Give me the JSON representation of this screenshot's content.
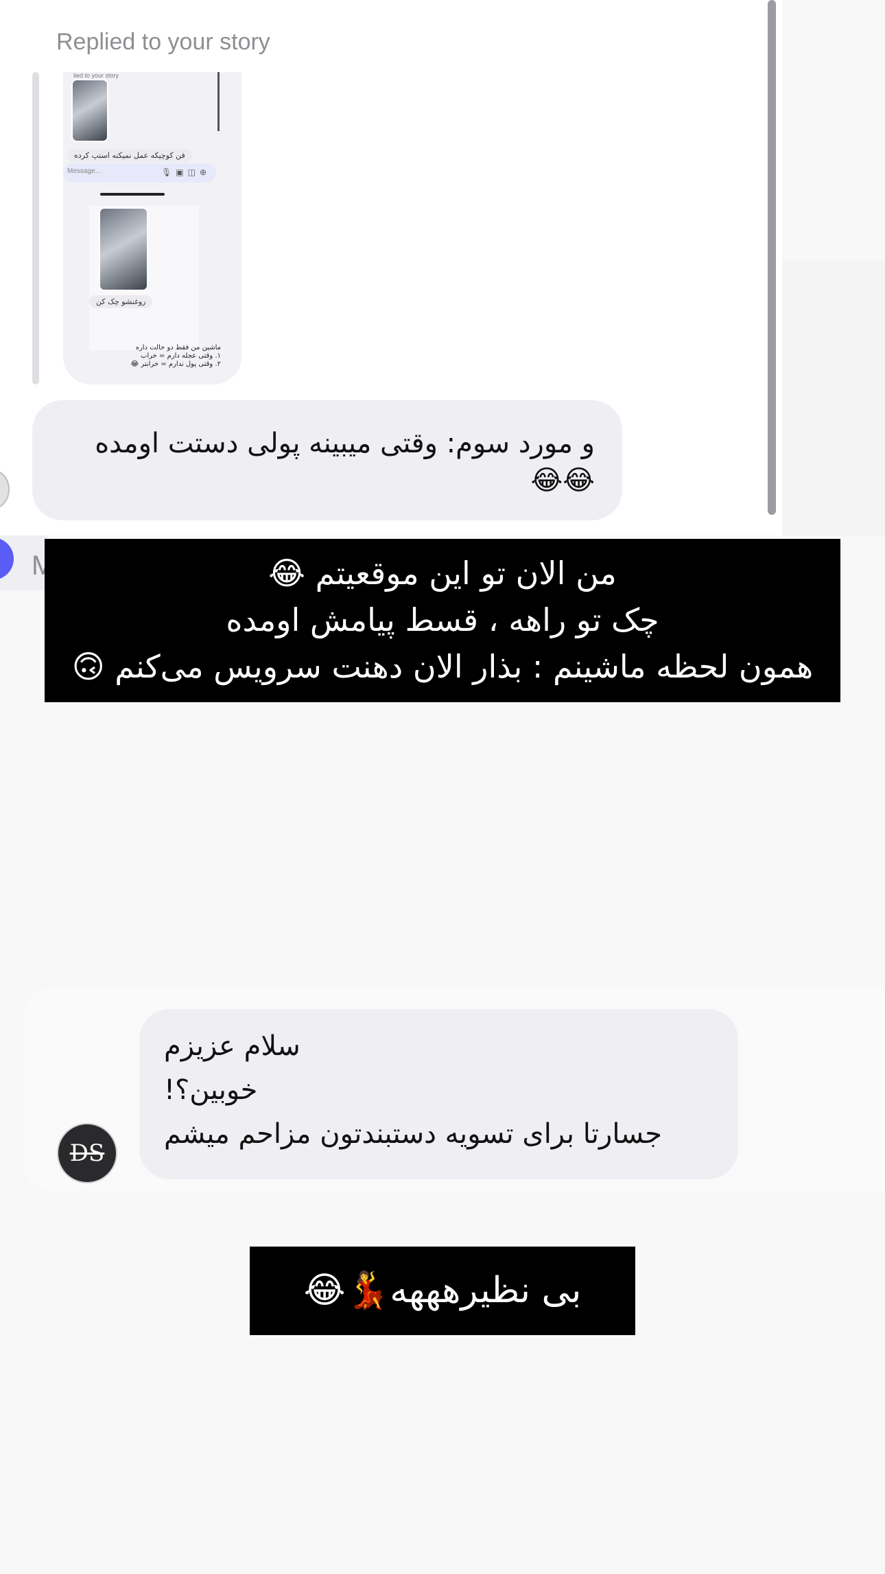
{
  "story_reply": {
    "label": "Replied to your story",
    "thumbnail": {
      "caption": "lied to your story",
      "message_1": "فن کوچیکه عمل نمیکنه استپ کرده",
      "input_placeholder": "Message...",
      "message_2": "روغنشو چک کن",
      "text": "ماشین من فقط دو حالت داره\n۱. وقتی عجله دارم = خراب\n۲. وقتی پول ندارم = خرابتر 😂"
    }
  },
  "messages": [
    {
      "text": "و مورد سوم: وقتی میبینه پولی دستت اومده 😂😂"
    }
  ],
  "composer": {
    "placeholder": "M"
  },
  "overlay_caption_1": {
    "line1": "من الان تو این موقعیتم 😂",
    "line2": "چک تو راهه ، قسط پیامش اومده",
    "line3": "همون لحظه ماشینم : بذار الان دهنت سرویس می‌کنم 🙃"
  },
  "incoming_message": {
    "avatar_initials": "DS",
    "line1": "سلام عزیزم",
    "line2": "خوبین؟!",
    "line3": "جسارتا برای تسویه دستبندتون مزاحم میشم"
  },
  "overlay_caption_2": {
    "text": "بی نظیرهههه💃😂"
  },
  "colors": {
    "bubble": "#efeff3",
    "accent": "#5b5bf6",
    "caption_bg": "#000000",
    "label_gray": "#8e8e93"
  }
}
